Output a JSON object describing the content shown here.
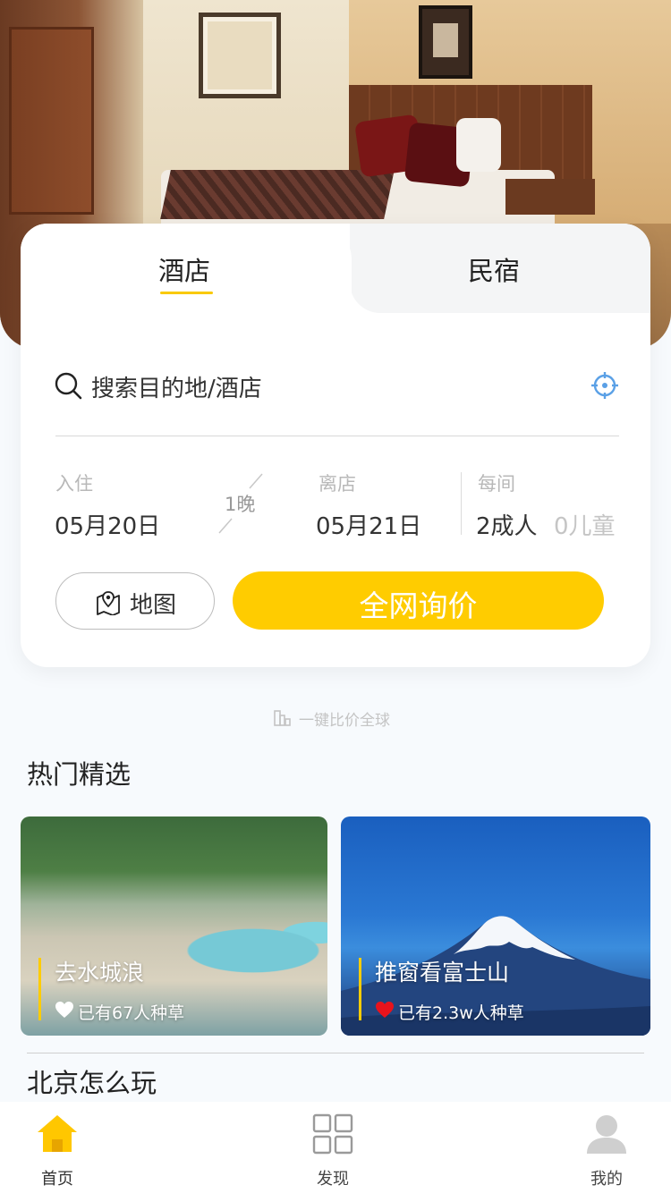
{
  "booking": {
    "tabs": [
      {
        "label": "酒店",
        "active": true
      },
      {
        "label": "民宿",
        "active": false
      }
    ],
    "search": {
      "placeholder": "搜索目的地/酒店",
      "icon": "search-icon",
      "locate_icon": "locate-icon"
    },
    "check_in": {
      "label": "入住",
      "date": "05月20日"
    },
    "nights": "1晚",
    "check_out": {
      "label": "离店",
      "date": "05月21日"
    },
    "guests": {
      "label": "每间",
      "adults": "2成人",
      "children": "0儿童"
    },
    "map_button": "地图",
    "search_button": "全网询价"
  },
  "slogan": "一键比价全球",
  "hot_section": {
    "title": "热门精选",
    "items": [
      {
        "title": "去水城浪",
        "likes": "已有67人种草",
        "liked": false
      },
      {
        "title": "推窗看富士山",
        "likes": "已有2.3w人种草",
        "liked": true
      }
    ]
  },
  "beijing_section": {
    "title": "北京怎么玩"
  },
  "tabbar": {
    "items": [
      {
        "label": "首页",
        "icon": "home-icon",
        "active": true
      },
      {
        "label": "发现",
        "icon": "grid-icon",
        "active": false
      },
      {
        "label": "我的",
        "icon": "user-icon",
        "active": false
      }
    ]
  },
  "colors": {
    "accent": "#ffcc00",
    "heart_liked": "#e8131c",
    "locate": "#5aa0e6"
  }
}
